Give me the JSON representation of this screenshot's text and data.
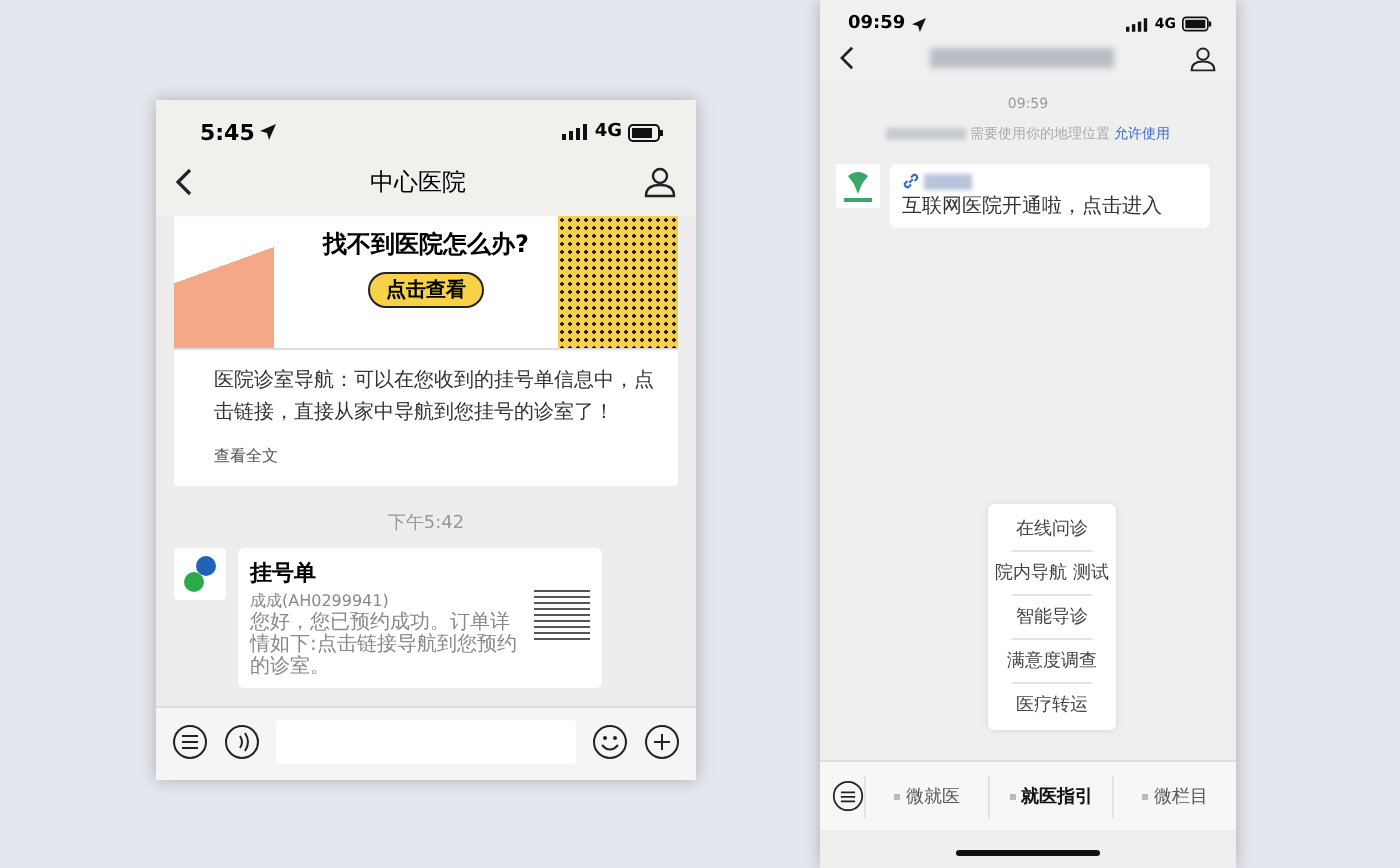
{
  "left_phone": {
    "status_bar": {
      "time": "5:45",
      "network": "4G"
    },
    "nav_bar": {
      "title": "中心医院"
    },
    "article_card": {
      "banner_heading": "找不到医院怎么办?",
      "banner_button": "点击查看",
      "summary": "医院诊室导航：可以在您收到的挂号单信息中，点击链接，直接从家中导航到您挂号的诊室了！",
      "read_more": "查看全文"
    },
    "timestamp": "下午5:42",
    "message_card": {
      "title": "挂号单",
      "subtitle": "成成(AH0299941)",
      "body": "您好，您已预约成功。订单详情如下:点击链接导航到您预约的诊室。"
    }
  },
  "right_phone": {
    "status_bar": {
      "time": "09:59",
      "network": "4G"
    },
    "timestamp": "09:59",
    "location_notice": {
      "text": "需要使用你的地理位置",
      "link": "允许使用"
    },
    "message": {
      "text": "互联网医院开通啦，点击进入"
    },
    "popup_menu": [
      "在线问诊",
      "院内导航 测试",
      "智能导诊",
      "满意度调查",
      "医疗转运"
    ],
    "bottom_menu": [
      {
        "label": "微就医",
        "selected": false
      },
      {
        "label": "就医指引",
        "selected": true
      },
      {
        "label": "微栏目",
        "selected": false
      }
    ]
  }
}
